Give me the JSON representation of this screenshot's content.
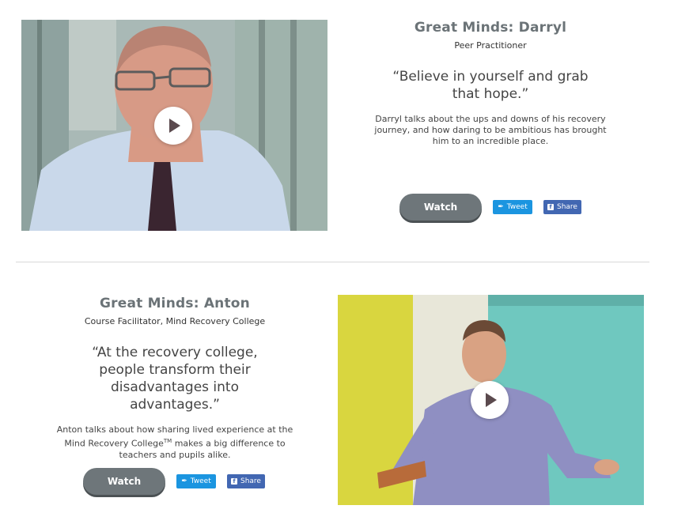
{
  "items": [
    {
      "title": "Great Minds: Darryl",
      "role": "Peer Practitioner",
      "quote_lines": [
        "“Believe in yourself and grab",
        "that hope.”"
      ],
      "desc_lines": [
        "Darryl talks about the ups and downs of his recovery",
        "journey, and how daring to be ambitious has brought",
        "him to an incredible place."
      ],
      "watch_label": "Watch",
      "tweet_label": "Tweet",
      "share_label": "Share"
    },
    {
      "title": "Great Minds: Anton",
      "role": "Course Facilitator, Mind Recovery College",
      "quote_lines": [
        "“At the recovery college,",
        "people transform their",
        "disadvantages into",
        "advantages.”"
      ],
      "desc_line1": "Anton talks about how sharing lived experience at the",
      "desc_line2_pre": "Mind Recovery College",
      "desc_line2_sup": "TM",
      "desc_line2_post": " makes a big difference to",
      "desc_line3": "teachers and pupils alike.",
      "watch_label": "Watch",
      "tweet_label": "Tweet",
      "share_label": "Share"
    }
  ],
  "colors": {
    "title": "#6b7377",
    "watch_button": "#6e767a",
    "tweet_button": "#1b95e0",
    "share_button": "#4267b2"
  },
  "icons": {
    "play": "play-icon",
    "tweet": "twitter-bird-icon",
    "share": "facebook-f-icon"
  }
}
